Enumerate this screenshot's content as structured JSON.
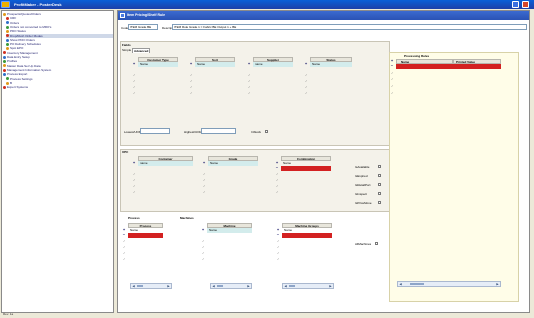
{
  "window": {
    "title": "ProfitMaker - PosterDesk"
  },
  "sidebar": {
    "items": [
      {
        "label": "Prospects/Quotes/Orders",
        "sel": false
      },
      {
        "label": "CRF",
        "sel": false
      },
      {
        "label": "Orders",
        "sel": false
      },
      {
        "label": "Orders not converted to MRO's",
        "sel": false
      },
      {
        "label": "PDO Status",
        "sel": false
      },
      {
        "label": "Drop/Rush Order Modes",
        "sel": true
      },
      {
        "label": "Show PDO Orders",
        "sel": false
      },
      {
        "label": "PO Delivery Schedules",
        "sel": false
      },
      {
        "label": "Spot EPO",
        "sel": false
      },
      {
        "label": "Inventory Management",
        "sel": false
      },
      {
        "label": "Data Entry Setup",
        "sel": false
      },
      {
        "label": "Profiles",
        "sel": false
      },
      {
        "label": "Master Data Set Up Data",
        "sel": false
      },
      {
        "label": "Management Information System",
        "sel": false
      },
      {
        "label": "Process Export",
        "sel": false
      },
      {
        "label": "Process Settings",
        "sel": false
      },
      {
        "label": "B",
        "sel": false
      },
      {
        "label": "Expert Systems",
        "sel": false
      }
    ],
    "status": "Rev. 1a"
  },
  "content": {
    "title": "Item Pricing/Shelf Rule",
    "code_label": "Code",
    "code_value": "ITEM Grade BE",
    "description_label": "Description",
    "description_value": "ITEM Rule Grade 1 = Fabric BE Output 1 + BE",
    "fields_section": "Fields",
    "tab_simple": "Simple",
    "tab_advanced": "Advanced",
    "grids_top": [
      {
        "header": "Customer Type",
        "row": "Name"
      },
      {
        "header": "Sort",
        "row": "Name"
      },
      {
        "header": "Supplier",
        "row": "name"
      },
      {
        "header": "Status",
        "row": "Name"
      }
    ],
    "lower_fields": [
      {
        "label": "Lowest/UOM"
      },
      {
        "label": "Highest/UOM"
      }
    ],
    "in_stock_label": "InStock",
    "upc_section": "UPC",
    "grids_upc": [
      {
        "header": "Container",
        "row": "name"
      },
      {
        "header": "Grade",
        "row": "Name"
      },
      {
        "header": "Combination",
        "row": "Name"
      }
    ],
    "upc_options": [
      "IsAvailable",
      "IsExpired",
      "IsRetailPort",
      "IsInspect",
      "IsPriceMove"
    ],
    "process_label": "Process",
    "machines_label": "Machines",
    "grids_process": [
      {
        "header": "Process",
        "row": "Name"
      },
      {
        "header": "Machine",
        "row": "Name"
      },
      {
        "header": "Machine Groups",
        "row": "Name"
      }
    ],
    "all_machines_label": "AllMachines",
    "right_grid": {
      "header": "Processing Rules",
      "col1": "Name",
      "col2": "Printed Value"
    }
  }
}
